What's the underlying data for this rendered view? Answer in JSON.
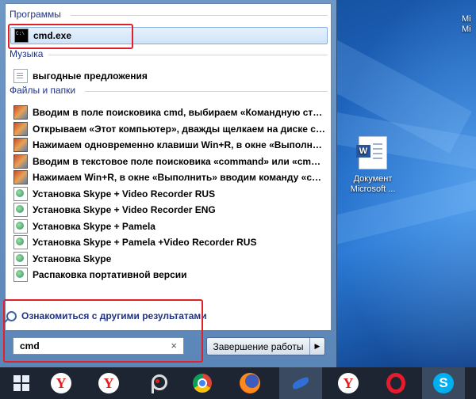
{
  "start_menu": {
    "groups": [
      {
        "header": "Программы",
        "items": [
          {
            "label": "cmd.exe",
            "icon": "cmd-icon",
            "selected": true
          }
        ]
      },
      {
        "header": "Музыка",
        "items": [
          {
            "label": "выгодные предложения",
            "icon": "file-icon"
          }
        ]
      },
      {
        "header": "Файлы и папки",
        "items": [
          {
            "label": "Вводим в поле поисковика  cmd, выбираем «Командную стро...",
            "icon": "image-icon"
          },
          {
            "label": "Открываем «Этот компьютер», дважды щелкаем на диске с у...",
            "icon": "image-icon"
          },
          {
            "label": "Нажимаем одновременно клавиши Win+R, в окне «Выполнит...",
            "icon": "image-icon"
          },
          {
            "label": "Вводим в текстовое поле поисковика «command» или «cmd»,...",
            "icon": "image-icon"
          },
          {
            "label": "Нажимаем Win+R, в окне «Выполнить» вводим команду «cmd»",
            "icon": "image-icon"
          },
          {
            "label": "Установка Skype + Video Recorder RUS",
            "icon": "globe-icon"
          },
          {
            "label": "Установка Skype + Video Recorder ENG",
            "icon": "globe-icon"
          },
          {
            "label": "Установка Skype + Pamela",
            "icon": "globe-icon"
          },
          {
            "label": "Установка Skype + Pamela +Video Recorder RUS",
            "icon": "globe-icon"
          },
          {
            "label": "Установка Skype",
            "icon": "globe-icon"
          },
          {
            "label": "Распаковка портативной версии",
            "icon": "globe-icon"
          }
        ]
      }
    ],
    "more_results": "Ознакомиться с другими результатами",
    "search": {
      "value": "cmd",
      "clear_glyph": "×"
    },
    "shutdown": {
      "label": "Завершение работы",
      "arrow": "▶"
    }
  },
  "desktop": {
    "icon_label": "Документ Microsoft ...",
    "icon_letter": "W",
    "edge_label": "Mi",
    "edge_label_2": "Mi"
  },
  "taskbar": {
    "buttons": [
      {
        "name": "start-button",
        "icon": "windows-logo-icon"
      },
      {
        "name": "taskbar-yandex-1",
        "icon": "yandex-browser-icon",
        "glyph": "Y"
      },
      {
        "name": "taskbar-yandex-2",
        "icon": "yandex-browser-icon",
        "glyph": "Y"
      },
      {
        "name": "taskbar-pin",
        "icon": "pin-app-icon"
      },
      {
        "name": "taskbar-chrome",
        "icon": "chrome-icon"
      },
      {
        "name": "taskbar-firefox",
        "icon": "firefox-icon"
      },
      {
        "name": "taskbar-swift",
        "icon": "swift-app-icon",
        "active": true
      },
      {
        "name": "taskbar-yandex-3",
        "icon": "yandex-browser-icon",
        "glyph": "Y"
      },
      {
        "name": "taskbar-opera",
        "icon": "opera-icon"
      },
      {
        "name": "taskbar-skype",
        "icon": "skype-icon",
        "glyph": "S",
        "active": true
      }
    ]
  },
  "colors": {
    "highlight_box": "#e0202a",
    "header_text": "#1e3287"
  }
}
